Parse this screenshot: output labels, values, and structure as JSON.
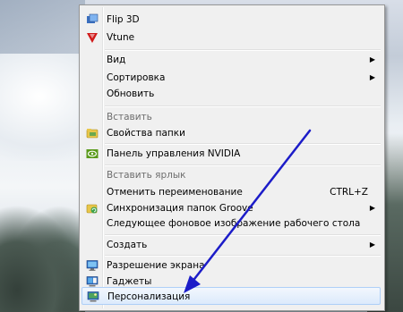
{
  "context_menu": {
    "items": [
      {
        "label": "Flip 3D",
        "icon": "flip3d-icon"
      },
      {
        "label": "Vtune",
        "icon": "vtune-icon"
      },
      {
        "label": "Вид",
        "submenu": true
      },
      {
        "label": "Сортировка",
        "submenu": true
      },
      {
        "label": "Обновить"
      },
      {
        "label": "Вставить",
        "disabled": true
      },
      {
        "label": "Свойства папки",
        "icon": "folder-properties-icon"
      },
      {
        "label": "Панель управления NVIDIA",
        "icon": "nvidia-icon"
      },
      {
        "label": "Вставить ярлык",
        "disabled": true
      },
      {
        "label": "Отменить переименование",
        "shortcut": "CTRL+Z"
      },
      {
        "label": "Синхронизация папок Groove",
        "icon": "groove-sync-icon",
        "submenu": true
      },
      {
        "label": "Следующее фоновое изображение рабочего стола"
      },
      {
        "label": "Создать",
        "submenu": true
      },
      {
        "label": "Разрешение экрана",
        "icon": "screen-resolution-icon"
      },
      {
        "label": "Гаджеты",
        "icon": "gadgets-icon"
      },
      {
        "label": "Персонализация",
        "icon": "personalization-icon",
        "highlighted": true
      }
    ]
  },
  "colors": {
    "menu_background": "#f0f0f0",
    "highlight": "#dceafc",
    "annotation_arrow": "#1c1cc8"
  }
}
